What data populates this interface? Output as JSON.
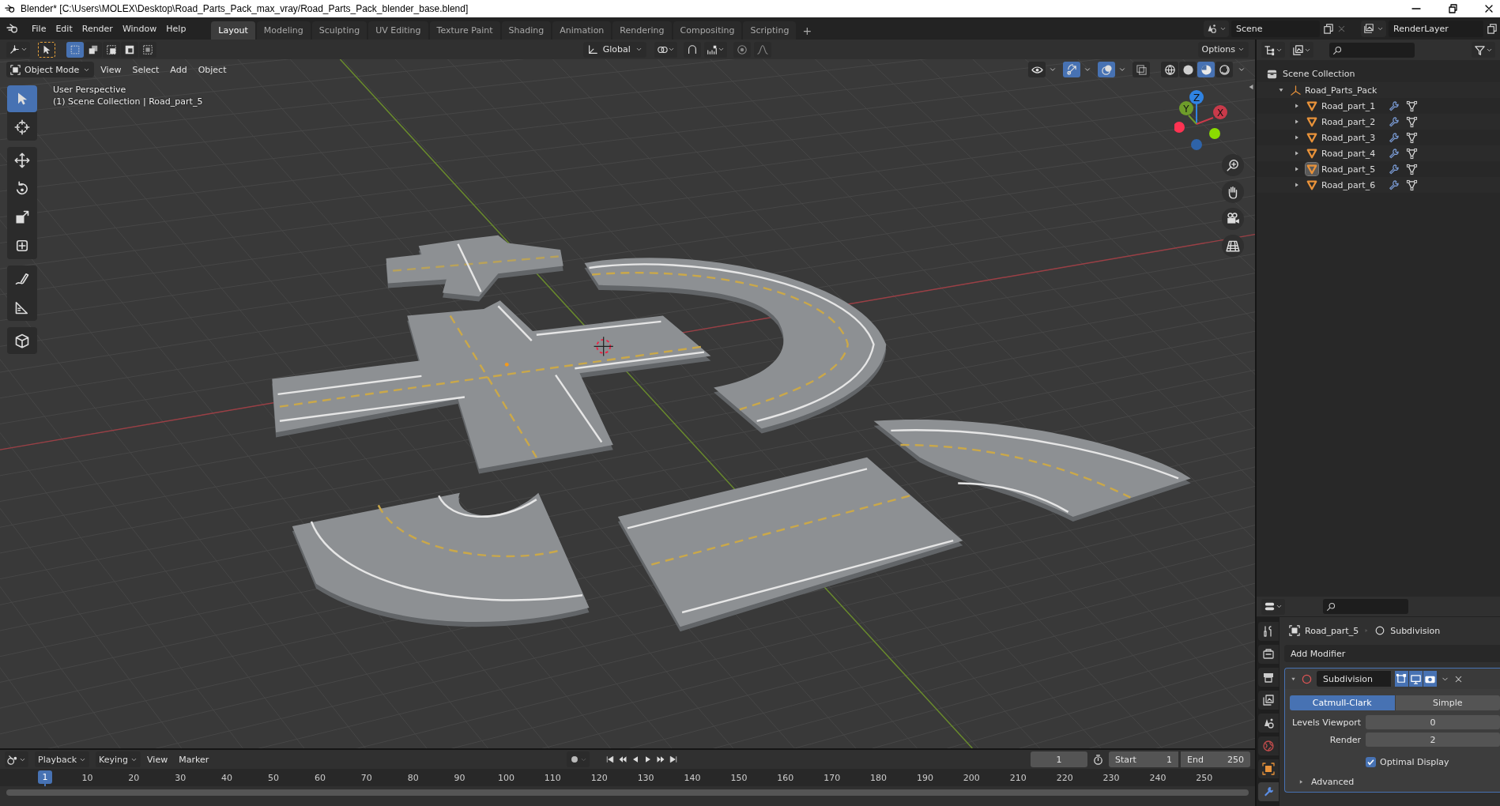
{
  "window": {
    "title": "Blender* [C:\\Users\\MOLEX\\Desktop\\Road_Parts_Pack_max_vray/Road_Parts_Pack_blender_base.blend]"
  },
  "menu_bar": {
    "items": [
      "File",
      "Edit",
      "Render",
      "Window",
      "Help"
    ]
  },
  "workspace_tabs": [
    {
      "label": "Layout",
      "selected": true
    },
    {
      "label": "Modeling",
      "selected": false
    },
    {
      "label": "Sculpting",
      "selected": false
    },
    {
      "label": "UV Editing",
      "selected": false
    },
    {
      "label": "Texture Paint",
      "selected": false
    },
    {
      "label": "Shading",
      "selected": false
    },
    {
      "label": "Animation",
      "selected": false
    },
    {
      "label": "Rendering",
      "selected": false
    },
    {
      "label": "Compositing",
      "selected": false
    },
    {
      "label": "Scripting",
      "selected": false
    }
  ],
  "add_workspace": "+",
  "scene": {
    "value": "Scene"
  },
  "view_layer": {
    "value": "RenderLayer"
  },
  "tool_header": {
    "select_modes": [
      {
        "selected": true
      },
      {
        "selected": false
      },
      {
        "selected": false
      },
      {
        "selected": false
      },
      {
        "selected": false
      }
    ],
    "orientation": "Global",
    "options": "Options"
  },
  "viewport_header": {
    "mode": "Object Mode",
    "menus": [
      "View",
      "Select",
      "Add",
      "Object"
    ],
    "toggles": [
      {
        "kind": "visibility",
        "on": false
      },
      {
        "kind": "gizmo",
        "on": true
      },
      {
        "kind": "overlay",
        "on": true
      },
      {
        "kind": "xray",
        "on": false
      }
    ],
    "shading": [
      {
        "kind": "wireframe",
        "selected": false
      },
      {
        "kind": "solid",
        "selected": false
      },
      {
        "kind": "material",
        "selected": true
      },
      {
        "kind": "rendered",
        "selected": false
      }
    ]
  },
  "viewport": {
    "info": [
      "User Perspective",
      "(1) Scene Collection | Road_part_5"
    ],
    "tools": [
      {
        "kind": "select",
        "selected": true
      },
      {
        "kind": "cursor",
        "selected": false
      },
      {
        "kind": "move",
        "selected": false
      },
      {
        "kind": "rotate",
        "selected": false
      },
      {
        "kind": "scale",
        "selected": false
      },
      {
        "kind": "transform",
        "selected": false
      },
      {
        "kind": "annotate",
        "selected": false
      },
      {
        "kind": "measure",
        "selected": false
      },
      {
        "kind": "add_cube",
        "selected": false
      }
    ],
    "gizmo_axes": [
      "Z",
      "Y",
      "X"
    ]
  },
  "outliner": {
    "root": "Scene Collection",
    "items": [
      {
        "label": "Road_Parts_Pack",
        "expanded": true,
        "children": [
          {
            "label": "Road_part_1",
            "active": false
          },
          {
            "label": "Road_part_2",
            "active": false
          },
          {
            "label": "Road_part_3",
            "active": false
          },
          {
            "label": "Road_part_4",
            "active": false
          },
          {
            "label": "Road_part_5",
            "active": true
          },
          {
            "label": "Road_part_6",
            "active": false
          }
        ]
      }
    ]
  },
  "properties": {
    "tabs": [
      {
        "kind": "tool",
        "selected": false
      },
      {
        "kind": "render",
        "selected": false
      },
      {
        "kind": "output",
        "selected": false
      },
      {
        "kind": "view_layer",
        "selected": false
      },
      {
        "kind": "scene",
        "selected": false
      },
      {
        "kind": "world",
        "selected": false
      },
      {
        "kind": "object",
        "selected": false
      },
      {
        "kind": "modifiers",
        "selected": true
      }
    ],
    "breadcrumb": [
      "Road_part_5",
      "Subdivision"
    ],
    "add_modifier": "Add Modifier",
    "modifier": {
      "name": "Subdivision",
      "expanded": true,
      "toggles": [
        {
          "kind": "edit_mode",
          "on": true
        },
        {
          "kind": "viewport",
          "on": true
        },
        {
          "kind": "render",
          "on": true
        }
      ],
      "types": [
        {
          "label": "Catmull-Clark",
          "selected": true
        },
        {
          "label": "Simple",
          "selected": false
        }
      ],
      "fields": [
        {
          "label": "Levels Viewport",
          "value": "0"
        },
        {
          "label": "Render",
          "value": "2"
        }
      ],
      "optimal_display": {
        "label": "Optimal Display",
        "checked": true
      },
      "advanced": {
        "label": "Advanced",
        "expanded": false
      }
    }
  },
  "timeline": {
    "menus": [
      "Playback",
      "Keying",
      "View",
      "Marker"
    ],
    "auto_keying": {
      "on": false
    },
    "current_frame": "1",
    "start_label": "Start",
    "start": "1",
    "end_label": "End",
    "end": "250",
    "ruler_current": "1",
    "ruler_ticks": [
      "10",
      "20",
      "30",
      "40",
      "50",
      "60",
      "70",
      "80",
      "90",
      "100",
      "110",
      "120",
      "130",
      "140",
      "150",
      "160",
      "170",
      "180",
      "190",
      "200",
      "210",
      "220",
      "230",
      "240",
      "250"
    ]
  }
}
